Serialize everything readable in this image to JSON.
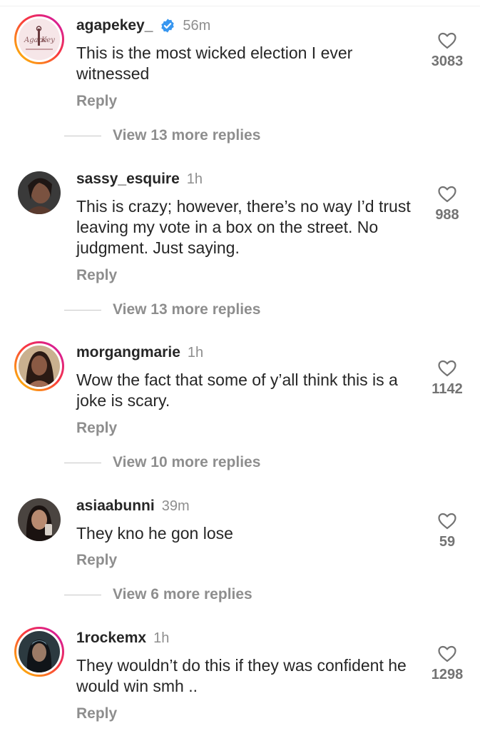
{
  "comments": [
    {
      "username": "agapekey_",
      "verified": true,
      "time": "56m",
      "text": "This is the most wicked election I ever witnessed",
      "likes": "3083",
      "reply_label": "Reply",
      "view_replies": "View 13 more replies",
      "story_ring": true
    },
    {
      "username": "sassy_esquire",
      "verified": false,
      "time": "1h",
      "text": "This is crazy; however, there’s no way I’d trust leaving my vote in a box on the street. No judgment. Just saying.",
      "likes": "988",
      "reply_label": "Reply",
      "view_replies": "View 13 more replies",
      "story_ring": false
    },
    {
      "username": "morgangmarie",
      "verified": false,
      "time": "1h",
      "text": "Wow the fact that some of y’all think this is a joke is scary.",
      "likes": "1142",
      "reply_label": "Reply",
      "view_replies": "View 10 more replies",
      "story_ring": true
    },
    {
      "username": "asiaabunni",
      "verified": false,
      "time": "39m",
      "text": "They kno he gon lose",
      "likes": "59",
      "reply_label": "Reply",
      "view_replies": "View 6 more replies",
      "story_ring": false
    },
    {
      "username": "1rockemx",
      "verified": false,
      "time": "1h",
      "text": "They wouldn’t do this if they was confident he would win smh ..",
      "likes": "1298",
      "reply_label": "Reply",
      "view_replies": "",
      "story_ring": true
    }
  ],
  "colors": {
    "text": "#262626",
    "secondary": "#8e8e8e",
    "verified_blue": "#3897f0"
  }
}
